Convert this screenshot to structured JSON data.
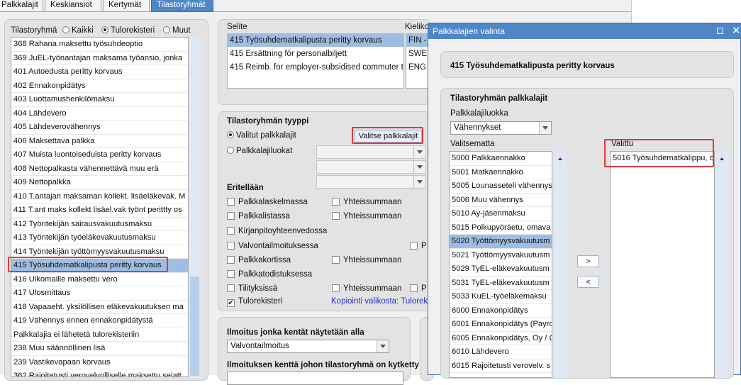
{
  "tabs": [
    {
      "label": "Palkkalajit",
      "active": false
    },
    {
      "label": "Keskiansiot",
      "active": false
    },
    {
      "label": "Kertymät",
      "active": false
    },
    {
      "label": "Tilastoryhmät",
      "active": true
    }
  ],
  "left": {
    "group_label": "Tilastoryhmä",
    "radio_all": "Kaikki",
    "radio_tulo": "Tulorekisteri",
    "radio_muut": "Muut",
    "items": [
      "368 Rahana maksettu työsuhdeoptio",
      "369 JuEL-työnantajan maksama työansio, jonka",
      "401 Autoedusta peritty korvaus",
      "402 Ennakonpidätys",
      "403 Luottamushenkilömaksu",
      "404 Lähdevero",
      "405 Lähdeverovähennys",
      "406 Maksettava palkka",
      "407 Muista luontoiseduista peritty korvaus",
      "408 Nettopalkasta vähennettävä muu erä",
      "409 Nettopalkka",
      "410 T.antajan maksaman kollekt. lisäeläkevak. M",
      "411 T.ant maks kollekt lisäel.vak työnt perittty os",
      "412 Työntekijän sairausvakuutusmaksu",
      "413 Työntekijän työeläkevakuutusmaksu",
      "414 Työntekijän työttömyysvakuutusmaksu",
      "415 Työsuhdematkalipusta peritty korvaus",
      "416 Ulkomaille maksettu vero",
      "417 Ulosmittaus",
      "418 Vapaaeht. yksilöllisen eläkevakuutuksen ma",
      "419 Vähennys ennen ennakonpidätystä",
      "Palkkalajia ei lähetetä tulorekisteriin",
      "238 Muu säännöllinen lisä",
      "239 Vastikevapaan korvaus",
      "362 Rajoitetusti verovelvolliselle maksettu sejatt"
    ],
    "selected_index": 16
  },
  "selite": {
    "header": "Selite",
    "header2": "Kieliko",
    "rows": [
      {
        "text": "415 Työsuhdematkalipusta peritty korvaus",
        "lang": "FIN -"
      },
      {
        "text": "415 Ersättning för personalbiljett",
        "lang": "SWE"
      },
      {
        "text": "415 Reimb. for employer-subsidised commuter t",
        "lang": "ENG"
      }
    ]
  },
  "type": {
    "header": "Tilastoryhmän tyyppi",
    "radio_valitut": "Valitut palkkalajit",
    "radio_luokat": "Palkkalajiluokat",
    "select_button": "Valitse palkkalajit",
    "eritellaan": "Eritellään",
    "checks": [
      {
        "label": "Palkkalaskelmassa",
        "checked": false
      },
      {
        "label": "Palkkalistassa",
        "checked": false
      },
      {
        "label": "Kirjanpitoyhteenvedossa",
        "checked": false
      },
      {
        "label": "Valvontailmoituksessa",
        "checked": false
      },
      {
        "label": "Palkkakortissa",
        "checked": false
      },
      {
        "label": "Palkkatodistuksessa",
        "checked": false
      },
      {
        "label": "Tilityksissä",
        "checked": false
      },
      {
        "label": "Tulorekisteri",
        "checked": true
      }
    ],
    "yht_label": "Yhteissummaan",
    "p_label": "P",
    "copy_text": "Kopiointi valikosta: Tulorek"
  },
  "ilmoitus": {
    "label1": "Ilmoitus jonka kentät näytetään alla",
    "value1": "Valvontailmoitus",
    "label2": "Ilmoituksen kenttä johon tilastoryhmä on kytketty"
  },
  "dialog": {
    "title": "Palkkalajien valinta",
    "info": "415 Työsuhdematkalipusta peritty korvaus",
    "group_title": "Tilastoryhmän palkkalajit",
    "luokka_label": "Palkkalajiluokka",
    "luokka_value": "Vähennykset",
    "unselected_label": "Valitsematta",
    "selected_label": "Valittu",
    "unselected": [
      "5000 Palkkaennakko",
      "5001 Matkaennakko",
      "5005 Lounasseteli vähennys",
      "5006 Muu vähennys",
      "5010 Ay-jäsenmaksu",
      "5015 Polkupyöräetu, omava",
      "5020 Työttömyysvakuutusm",
      "5021 Työttömyysvakuutusm",
      "5029 TyEL-eläkevakuutusm",
      "5031 TyEL-eläkevakuutusm",
      "5033 KuEL-työeläkemaksu",
      "6000 Ennakonpidätys",
      "6001 Ennakonpidätys (Payro",
      "6005 Ennakonpidätys, Oy / C",
      "6010 Lähdevero",
      "6015 Rajoitetusti verovelv. s"
    ],
    "unselected_selected_index": 6,
    "selected": [
      "5016 Työsuhdematkalippu, o"
    ],
    "add_button": ">",
    "remove_button": "<"
  }
}
